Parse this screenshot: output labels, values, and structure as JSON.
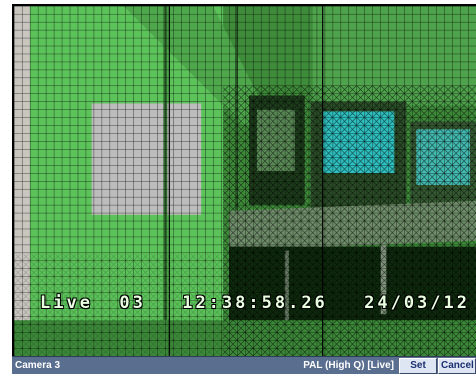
{
  "video": {
    "osd": {
      "camera": "Live  03",
      "time": "12:38:58.26",
      "date": "24/03/12"
    },
    "tint_color": "#5ec45a",
    "grid_color": "#000000"
  },
  "status_bar": {
    "camera_label": "Camera 3",
    "mode_label": "PAL (High Q) [Live]",
    "set_button": "Set",
    "cancel_button": "Cancel"
  }
}
